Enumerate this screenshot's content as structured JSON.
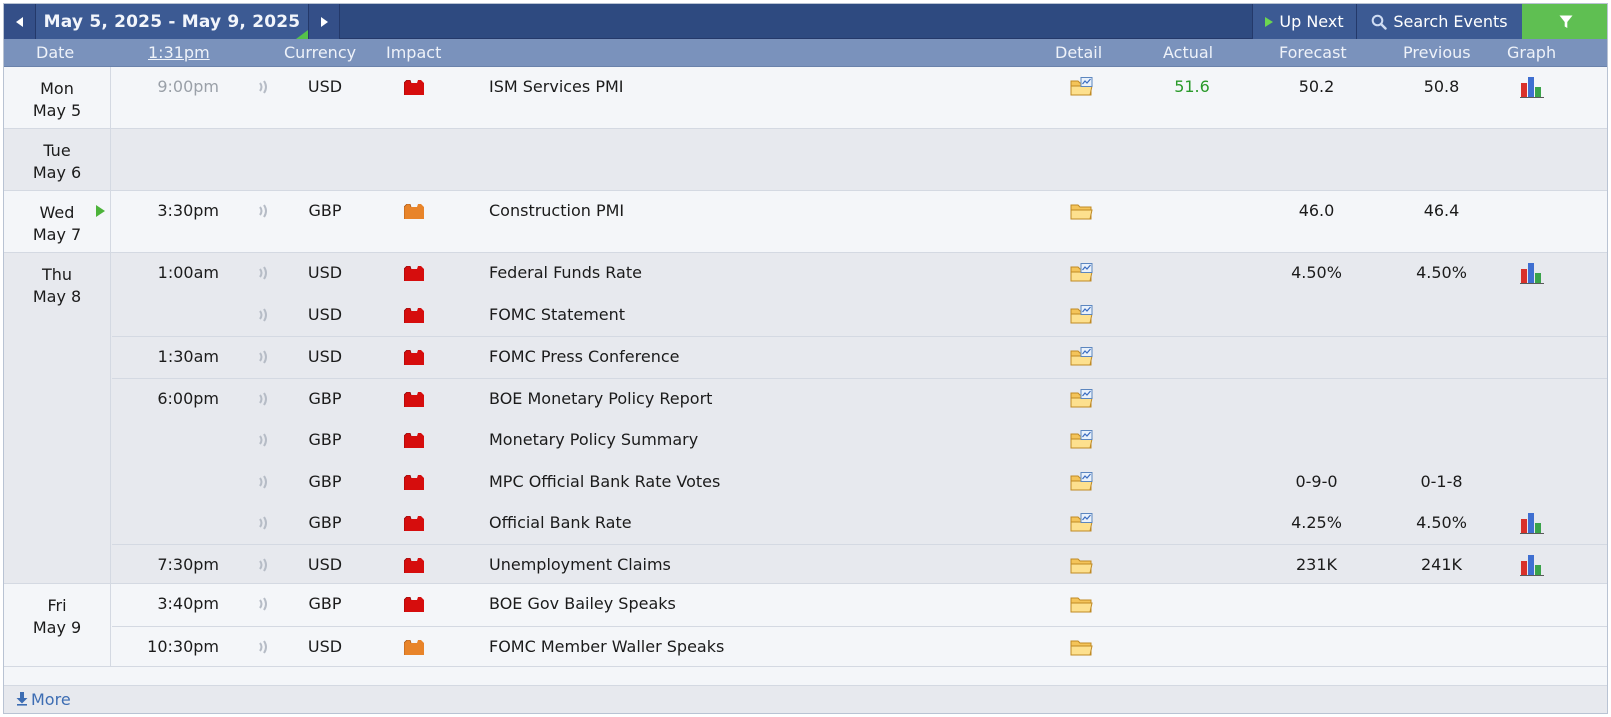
{
  "toolbar": {
    "date_range": "May 5, 2025 - May 9, 2025",
    "up_next_label": "Up Next",
    "search_label": "Search Events"
  },
  "header": {
    "date": "Date",
    "time": "1:31pm",
    "currency": "Currency",
    "impact": "Impact",
    "detail": "Detail",
    "actual": "Actual",
    "forecast": "Forecast",
    "previous": "Previous",
    "graph": "Graph"
  },
  "colors": {
    "impact_high": "#d60d0d",
    "impact_medium": "#e8842a",
    "actual_better": "#2a9a2a",
    "toolbar": "#2e4a80",
    "header": "#7a92bc",
    "filter": "#5fbf52"
  },
  "days": [
    {
      "day": "Mon",
      "date": "May 5"
    },
    {
      "day": "Tue",
      "date": "May 6"
    },
    {
      "day": "Wed",
      "date": "May 7"
    },
    {
      "day": "Thu",
      "date": "May 8"
    },
    {
      "day": "Fri",
      "date": "May 9"
    }
  ],
  "events": [
    {
      "time": "9:00pm",
      "currency": "USD",
      "impact": "high",
      "name": "ISM Services PMI",
      "actual": "51.6",
      "forecast": "50.2",
      "previous": "50.8",
      "graph": true,
      "icon": "folder-chart-icon"
    },
    {
      "time": "3:30pm",
      "currency": "GBP",
      "impact": "medium",
      "name": "Construction PMI",
      "actual": "",
      "forecast": "46.0",
      "previous": "46.4",
      "graph": false,
      "icon": "folder-icon"
    },
    {
      "time": "1:00am",
      "currency": "USD",
      "impact": "high",
      "name": "Federal Funds Rate",
      "actual": "",
      "forecast": "4.50%",
      "previous": "4.50%",
      "graph": true,
      "icon": "folder-chart-icon"
    },
    {
      "time": "",
      "currency": "USD",
      "impact": "high",
      "name": "FOMC Statement",
      "actual": "",
      "forecast": "",
      "previous": "",
      "graph": false,
      "icon": "folder-chart-icon"
    },
    {
      "time": "1:30am",
      "currency": "USD",
      "impact": "high",
      "name": "FOMC Press Conference",
      "actual": "",
      "forecast": "",
      "previous": "",
      "graph": false,
      "icon": "folder-chart-icon"
    },
    {
      "time": "6:00pm",
      "currency": "GBP",
      "impact": "high",
      "name": "BOE Monetary Policy Report",
      "actual": "",
      "forecast": "",
      "previous": "",
      "graph": false,
      "icon": "folder-chart-icon"
    },
    {
      "time": "",
      "currency": "GBP",
      "impact": "high",
      "name": "Monetary Policy Summary",
      "actual": "",
      "forecast": "",
      "previous": "",
      "graph": false,
      "icon": "folder-chart-icon"
    },
    {
      "time": "",
      "currency": "GBP",
      "impact": "high",
      "name": "MPC Official Bank Rate Votes",
      "actual": "",
      "forecast": "0-9-0",
      "previous": "0-1-8",
      "graph": false,
      "icon": "folder-chart-icon"
    },
    {
      "time": "",
      "currency": "GBP",
      "impact": "high",
      "name": "Official Bank Rate",
      "actual": "",
      "forecast": "4.25%",
      "previous": "4.50%",
      "graph": true,
      "icon": "folder-chart-icon"
    },
    {
      "time": "7:30pm",
      "currency": "USD",
      "impact": "high",
      "name": "Unemployment Claims",
      "actual": "",
      "forecast": "231K",
      "previous": "241K",
      "graph": true,
      "icon": "folder-icon"
    },
    {
      "time": "3:40pm",
      "currency": "GBP",
      "impact": "high",
      "name": "BOE Gov Bailey Speaks",
      "actual": "",
      "forecast": "",
      "previous": "",
      "graph": false,
      "icon": "folder-icon"
    },
    {
      "time": "10:30pm",
      "currency": "USD",
      "impact": "medium",
      "name": "FOMC Member Waller Speaks",
      "actual": "",
      "forecast": "",
      "previous": "",
      "graph": false,
      "icon": "folder-icon"
    }
  ],
  "footer": {
    "more_label": "More"
  }
}
